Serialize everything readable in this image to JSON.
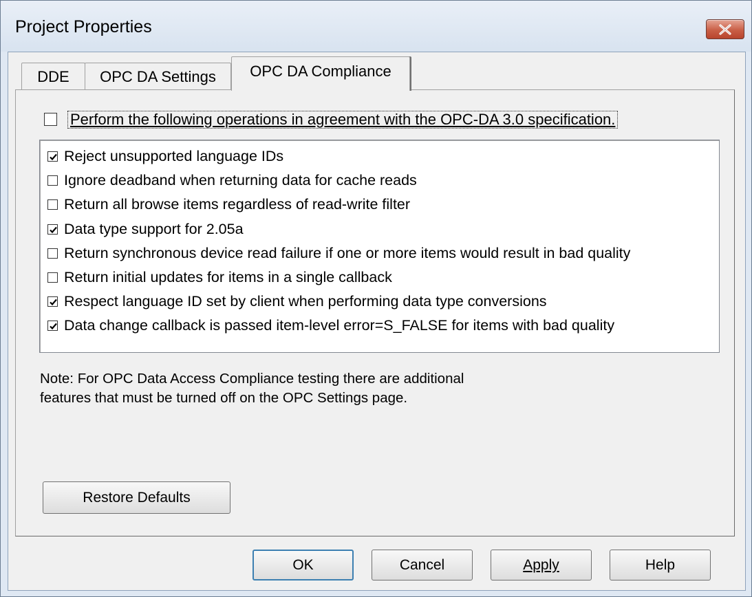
{
  "window": {
    "title": "Project Properties"
  },
  "tabs": [
    {
      "label": "DDE",
      "active": false
    },
    {
      "label": "OPC DA Settings",
      "active": false
    },
    {
      "label": "OPC DA Compliance",
      "active": true
    }
  ],
  "main_option": {
    "label": "Perform the following operations in agreement with the OPC-DA 3.0 specification.",
    "checked": false
  },
  "options": [
    {
      "label": "Reject unsupported language IDs",
      "checked": true
    },
    {
      "label": "Ignore deadband when returning data for cache reads",
      "checked": false
    },
    {
      "label": "Return all browse items regardless of read-write filter",
      "checked": false
    },
    {
      "label": "Data type support for 2.05a",
      "checked": true
    },
    {
      "label": "Return synchronous device read failure if one or more items would result in bad quality",
      "checked": false
    },
    {
      "label": "Return initial updates for items in a single callback",
      "checked": false
    },
    {
      "label": "Respect language ID set by client when performing data type conversions",
      "checked": true
    },
    {
      "label": "Data change callback is passed item-level error=S_FALSE for items with bad quality",
      "checked": true
    }
  ],
  "note": {
    "line1": "Note: For OPC Data Access Compliance testing there are additional",
    "line2": "features that must be turned off on the OPC Settings page."
  },
  "buttons": {
    "restore_defaults": "Restore Defaults",
    "ok": "OK",
    "cancel": "Cancel",
    "apply": "Apply",
    "help": "Help"
  },
  "icons": {
    "close": "close-x-icon",
    "checkmark": "checkmark-icon"
  }
}
